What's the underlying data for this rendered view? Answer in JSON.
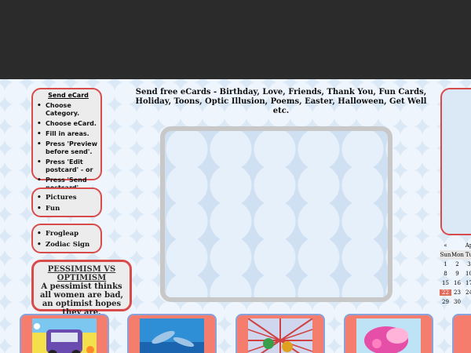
{
  "headline": "Send free eCards - Birthday, Love, Friends, Thank You, Fun Cards, Holiday, Toons, Optic Illusion, Poems, Easter, Halloween, Get Well etc.",
  "send_ecard": {
    "title": "Send eCard",
    "steps": [
      "Choose Category.",
      "Choose eCard.",
      "Fill in areas.",
      "Press 'Preview before send'.",
      "Press 'Edit postcard' - or",
      "Press 'Send postcard'."
    ]
  },
  "menu_a": [
    "Pictures",
    "Fun"
  ],
  "menu_b": [
    "Frogleap",
    "Zodiac Sign"
  ],
  "pessimism": {
    "title": "PESSIMISM VS OPTIMISM",
    "text": "A pessimist thinks all women are bad, an optimist hopes they are."
  },
  "calendar": {
    "month_partial": "Ap",
    "nav_left": "«",
    "days": [
      "Sun",
      "Mon",
      "Tu"
    ],
    "rows": [
      [
        "1",
        "2",
        "3"
      ],
      [
        "8",
        "9",
        "10"
      ],
      [
        "15",
        "16",
        "17"
      ],
      [
        "22",
        "23",
        "24"
      ],
      [
        "29",
        "30",
        ""
      ]
    ],
    "today": "22"
  },
  "thumbnails": [
    "cartoon-car",
    "dolphins",
    "i-love-you",
    "pink-flowers",
    "partial-card"
  ],
  "colors": {
    "accent": "#d94b4b",
    "thumb_bg": "#f47d6e",
    "thumb_border": "#8aa2dc",
    "page_bg": "#dbe9f6"
  }
}
